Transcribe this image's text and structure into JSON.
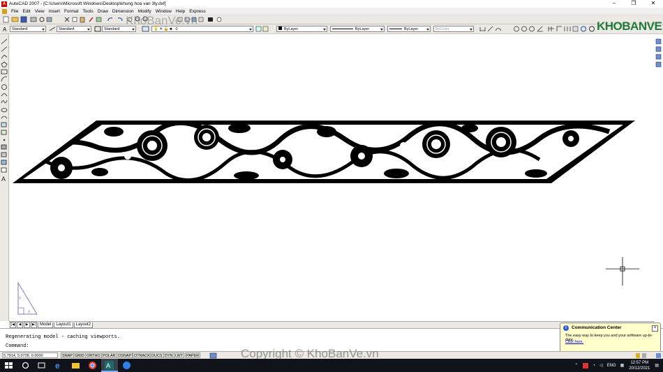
{
  "window": {
    "title": "AutoCAD 2007 - [C:\\Users\\Microsoft Windows\\Desktop\\khung hoa van 3ly.dxf]",
    "controls": [
      "–",
      "❐",
      "✕"
    ]
  },
  "menu": [
    "File",
    "Edit",
    "View",
    "Insert",
    "Format",
    "Tools",
    "Draw",
    "Dimension",
    "Modify",
    "Window",
    "Help",
    "Express"
  ],
  "styles": {
    "text_style": "Standard",
    "dim_style": "Standard",
    "table_style": "Standard"
  },
  "layers": {
    "current_layer": "0",
    "color": "ByLayer",
    "linetype": "ByLayer",
    "lineweight": "ByLayer",
    "plot_style": "ByColor"
  },
  "watermarks": {
    "top": "KhoBanVe.vn",
    "bottom": "Copyright © KhoBanVe.vn"
  },
  "logo": {
    "text": "KHOBANVE"
  },
  "layout_tabs": [
    "Model",
    "Layout1",
    "Layout2"
  ],
  "command": {
    "history": "Regenerating model - caching viewports.",
    "prompt": "Command:"
  },
  "status": {
    "coordinates": "5.7914, 5.0728, 0.0000",
    "toggles": [
      "SNAP",
      "GRID",
      "ORTHO",
      "POLAR",
      "OSNAP",
      "OTRACK",
      "DUCS",
      "DYN",
      "LWT",
      "PAPER"
    ]
  },
  "comm_center": {
    "title": "Communication Center",
    "message": "The easy way to keep you and your software up-to-date.",
    "link": "Click here."
  },
  "taskbar": {
    "language": "ENG",
    "time": "12:57 PM",
    "date": "20/12/2021"
  },
  "colors": {
    "toolbar_bg": "#ece9e4",
    "taskbar_bg": "#10131a",
    "logo_green": "#1f7a3c",
    "popup_bg": "#ffffcc"
  }
}
